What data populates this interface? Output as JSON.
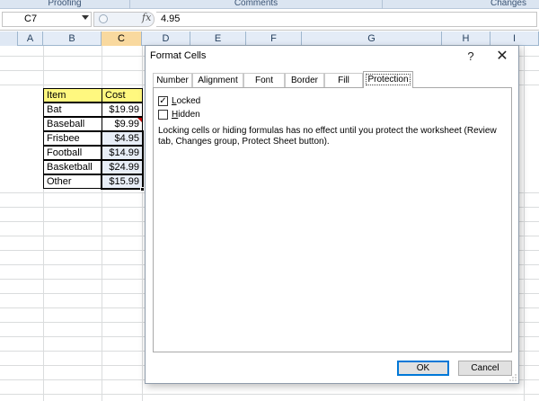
{
  "ribbon": {
    "groups": [
      "Proofing",
      "Comments",
      "Changes"
    ]
  },
  "formula_bar": {
    "name_box": "C7",
    "fx_label": "fx",
    "value": "4.95"
  },
  "columns": [
    "A",
    "B",
    "C",
    "D",
    "E",
    "F",
    "G",
    "H",
    "I"
  ],
  "active_column": "C",
  "table": {
    "headers": [
      "Item",
      "Cost"
    ],
    "rows": [
      [
        "Bat",
        "$19.99"
      ],
      [
        "Baseball",
        "$9.99"
      ],
      [
        "Frisbee",
        "$4.95"
      ],
      [
        "Football",
        "$14.99"
      ],
      [
        "Basketball",
        "$24.99"
      ],
      [
        "Other",
        "$15.99"
      ]
    ]
  },
  "dialog": {
    "title": "Format Cells",
    "help": "?",
    "close": "✕",
    "tabs": [
      "Number",
      "Alignment",
      "Font",
      "Border",
      "Fill",
      "Protection"
    ],
    "active_tab": "Protection",
    "locked": {
      "label_underlined": "L",
      "label_rest": "ocked",
      "checked": true,
      "check_glyph": "✓"
    },
    "hidden": {
      "label_underlined": "H",
      "label_rest": "idden",
      "checked": false
    },
    "note": "Locking cells or hiding formulas has no effect until you protect the worksheet (Review tab, Changes group, Protect Sheet button).",
    "ok_label": "OK",
    "cancel_label": "Cancel"
  },
  "colors": {
    "header_fill": "#fff87f",
    "active_col_header": "#f9d99f",
    "ok_button_border": "#0078d7",
    "comment_indicator": "#c00000"
  }
}
